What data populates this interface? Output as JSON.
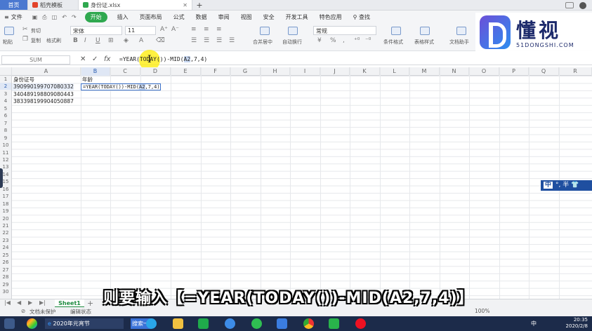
{
  "tabs": {
    "home": "首页",
    "template": "稻壳模板",
    "file": "身份证.xlsx",
    "add": "+"
  },
  "menu": {
    "file": "文件",
    "start": "开始",
    "items": [
      "插入",
      "页面布局",
      "公式",
      "数据",
      "审阅",
      "视图",
      "安全",
      "开发工具",
      "特色应用"
    ],
    "search": "查找"
  },
  "ribbon": {
    "paste": "粘贴",
    "cut": "剪切",
    "copy": "复制",
    "format_painter": "格式刷",
    "font_name": "宋体",
    "font_size": "11",
    "merge": "合并居中",
    "wrap": "自动换行",
    "number_format": "常规",
    "cond_format": "条件格式",
    "table_style": "表格样式",
    "doc_helper": "文档助手"
  },
  "formula_bar": {
    "name_box": "SUM",
    "fx": "fx",
    "cancel": "✕",
    "confirm": "✓",
    "formula_pre": "=YEAR(TODAY())-MID(",
    "formula_ref": "A2",
    "formula_post": ",7,4)"
  },
  "columns": [
    "A",
    "B",
    "C",
    "D",
    "E",
    "F",
    "G",
    "H",
    "I",
    "J",
    "K",
    "L",
    "M",
    "N",
    "O",
    "P",
    "Q",
    "R"
  ],
  "rows": [
    "1",
    "2",
    "3",
    "4",
    "5",
    "6",
    "7",
    "8",
    "9",
    "10",
    "11",
    "12",
    "13",
    "14",
    "15",
    "16",
    "17",
    "18",
    "19",
    "20",
    "21",
    "22",
    "23",
    "24",
    "25",
    "26",
    "27",
    "28",
    "29",
    "30"
  ],
  "cells": {
    "A1": "身份证号",
    "B1": "年龄",
    "A2": "390990199707080332",
    "A3": "340489198809080443",
    "A4": "383398199904050887",
    "B2_pre": "=YEAR(TODAY())-MID(",
    "B2_ref": "A2",
    "B2_post": ",7,4)"
  },
  "sheet": {
    "tab": "Sheet1",
    "add": "+"
  },
  "status": {
    "protect": "文档未保护",
    "mode": "编辑状态",
    "zoom": "100%"
  },
  "subtitle": "则要输入【=YEAR(TODAY())-MID(A2,7,4)】",
  "logo": {
    "cn": "懂视",
    "en": "51DONGSHI.COM"
  },
  "ime": {
    "lang": "中",
    "rest": "°, 半"
  },
  "taskbar": {
    "browser_tab": "2020年元宵节",
    "search": "搜索一下",
    "time": "20:35",
    "date": "2020/2/8",
    "lang": "中"
  },
  "colors": {
    "accent_green": "#2fa84f",
    "tab_blue": "#4a78d0",
    "taskbar": "#1c2b4a",
    "selection": "#3a70c8"
  }
}
